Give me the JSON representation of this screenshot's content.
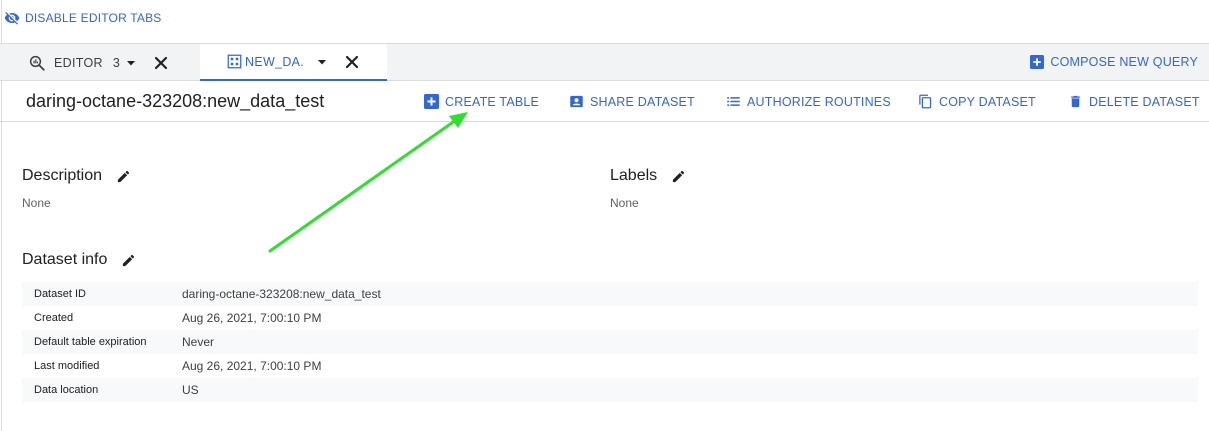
{
  "topbar": {
    "disable_tabs_label": "DISABLE EDITOR TABS"
  },
  "tabs": [
    {
      "label": "EDITOR",
      "count": "3"
    },
    {
      "label": "NEW_DA..."
    }
  ],
  "compose_label": "COMPOSE NEW QUERY",
  "dataset": {
    "title": "daring-octane-323208:new_data_test",
    "actions": {
      "create_table": "CREATE TABLE",
      "share_dataset": "SHARE DATASET",
      "authorize_routines": "AUTHORIZE ROUTINES",
      "copy_dataset": "COPY DATASET",
      "delete_dataset": "DELETE DATASET"
    }
  },
  "description": {
    "title": "Description",
    "value": "None"
  },
  "labels": {
    "title": "Labels",
    "value": "None"
  },
  "dataset_info": {
    "title": "Dataset info",
    "rows": [
      {
        "key": "Dataset ID",
        "value": "daring-octane-323208:new_data_test"
      },
      {
        "key": "Created",
        "value": "Aug 26, 2021, 7:00:10 PM"
      },
      {
        "key": "Default table expiration",
        "value": "Never"
      },
      {
        "key": "Last modified",
        "value": "Aug 26, 2021, 7:00:10 PM"
      },
      {
        "key": "Data location",
        "value": "US"
      }
    ]
  },
  "colors": {
    "accent": "#3367d6",
    "annotation_arrow": "#2ee02e"
  }
}
